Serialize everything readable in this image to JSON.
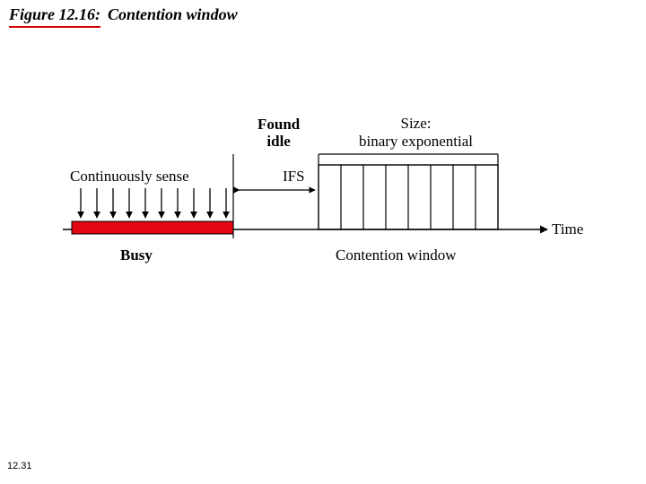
{
  "figure": {
    "number": "Figure 12.16:",
    "title": "Contention window"
  },
  "labels": {
    "found_idle_line1": "Found",
    "found_idle_line2": "idle",
    "size_line1": "Size:",
    "size_line2": "binary exponential",
    "continuously_sense": "Continuously sense",
    "ifs": "IFS",
    "busy": "Busy",
    "contention_window": "Contention window",
    "time": "Time"
  },
  "page": "12.31",
  "colors": {
    "busy_fill": "#e30613",
    "accent_underline": "#d00000"
  },
  "chart_data": {
    "type": "diagram",
    "title": "Contention window",
    "description": "CSMA/CA timeline: channel is sensed continuously while busy; after found idle, wait IFS, then back off over a contention window of binary-exponential size.",
    "sections": [
      {
        "name": "Busy",
        "note": "Continuously sense; arrows indicate repeated sensing",
        "sense_arrows": 10
      },
      {
        "name": "IFS",
        "note": "Inter-frame space gap between busy period and contention window"
      },
      {
        "name": "Contention window",
        "note": "Divided into time slots; size grows as binary exponential",
        "slots": 8
      }
    ],
    "axis": "Time"
  }
}
